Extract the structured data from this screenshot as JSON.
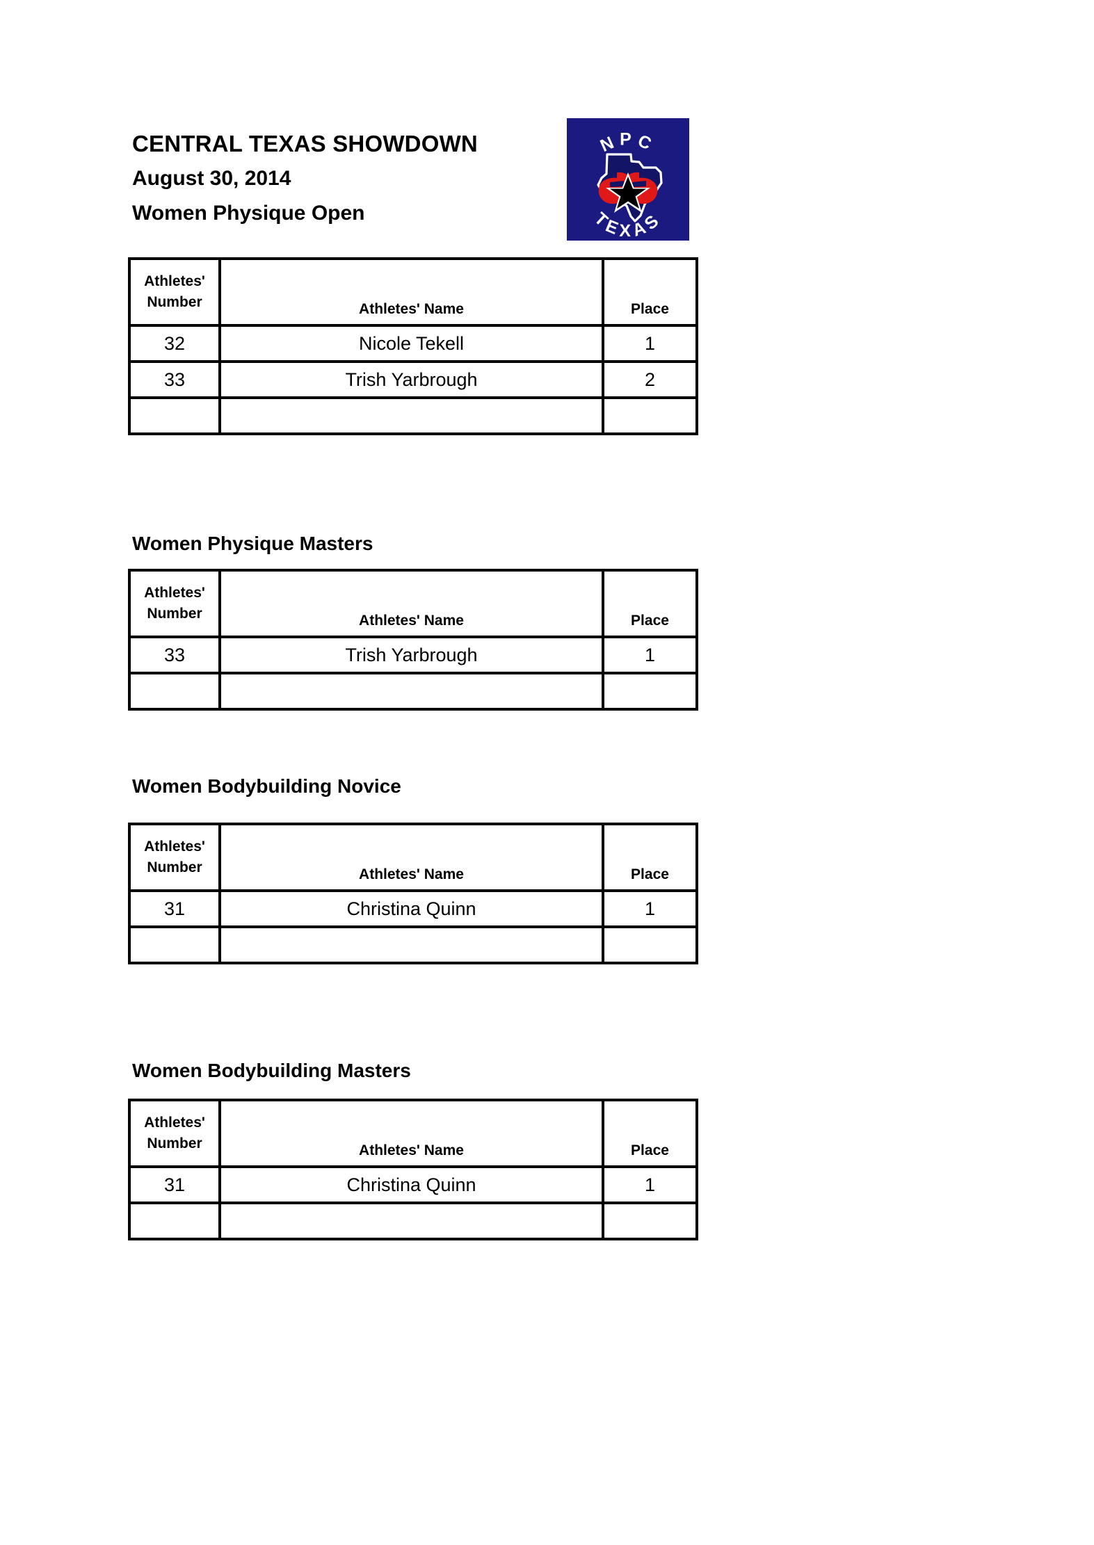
{
  "document": {
    "title": "CENTRAL TEXAS SHOWDOWN",
    "date": "August 30, 2014",
    "division": "Women Physique Open"
  },
  "logo": {
    "name": "npc-texas-logo",
    "top_text": "NPC",
    "bottom_text": "TEXAS",
    "background_color": "#1a1a80",
    "accent_color": "#e01818",
    "outline_color": "#ffffff",
    "star_color": "#000000"
  },
  "columns": {
    "number": "Athletes' Number",
    "number_line1": "Athletes'",
    "number_line2": "Number",
    "name": "Athletes' Name",
    "place": "Place"
  },
  "sections": [
    {
      "heading": "Women Physique Open",
      "heading_shown_in_header": true,
      "rows": [
        {
          "number": "32",
          "name": "Nicole Tekell",
          "place": "1"
        },
        {
          "number": "33",
          "name": "Trish Yarbrough",
          "place": "2"
        },
        {
          "number": "",
          "name": "",
          "place": ""
        }
      ]
    },
    {
      "heading": "Women Physique Masters",
      "heading_shown_in_header": false,
      "rows": [
        {
          "number": "33",
          "name": "Trish Yarbrough",
          "place": "1"
        },
        {
          "number": "",
          "name": "",
          "place": ""
        }
      ]
    },
    {
      "heading": "Women Bodybuilding Novice",
      "heading_shown_in_header": false,
      "rows": [
        {
          "number": "31",
          "name": "Christina Quinn",
          "place": "1"
        },
        {
          "number": "",
          "name": "",
          "place": ""
        }
      ]
    },
    {
      "heading": "Women Bodybuilding Masters",
      "heading_shown_in_header": false,
      "rows": [
        {
          "number": "31",
          "name": "Christina Quinn",
          "place": "1"
        },
        {
          "number": "",
          "name": "",
          "place": ""
        }
      ]
    }
  ]
}
